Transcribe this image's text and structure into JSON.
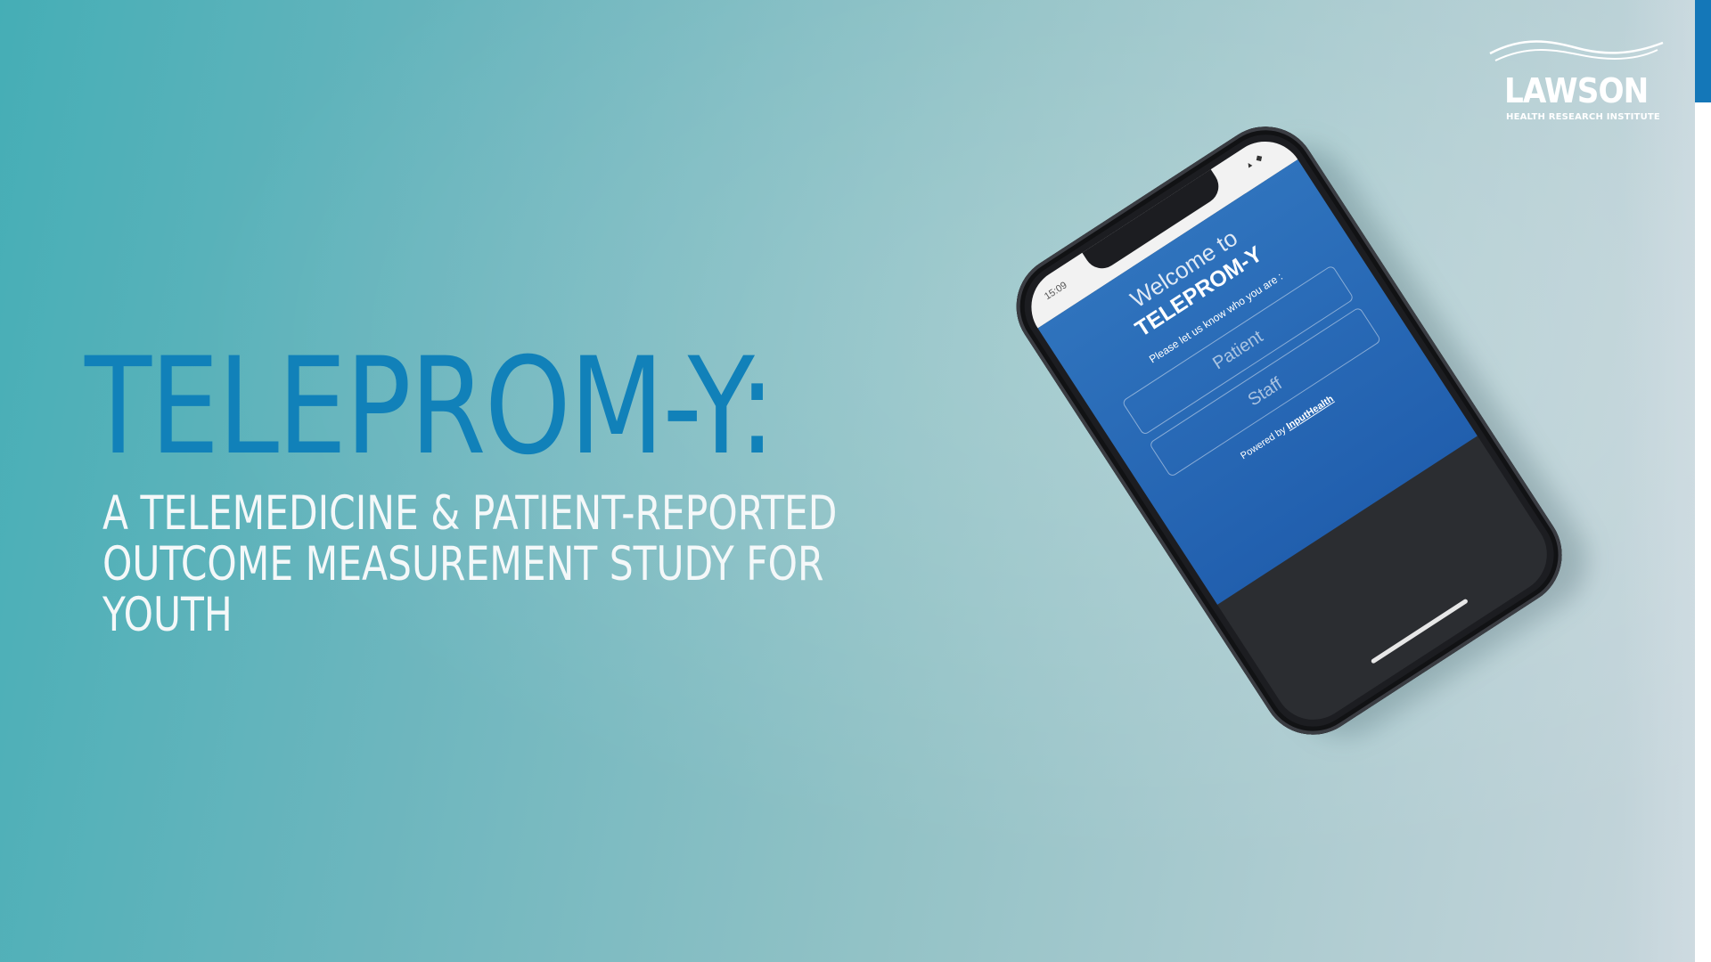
{
  "slide": {
    "title": "TELEPROM-Y:",
    "subtitle_lines": [
      "A TELEMEDICINE & PATIENT-REPORTED",
      "OUTCOME MEASUREMENT STUDY FOR",
      "YOUTH"
    ]
  },
  "logo": {
    "name": "LAWSON",
    "tagline": "HEALTH RESEARCH INSTITUTE"
  },
  "phone": {
    "status_time": "15:09",
    "welcome": "Welcome to",
    "app_title": "TELEPROM-Y",
    "prompt": "Please let us know who you are :",
    "patient_button": "Patient",
    "staff_button": "Staff",
    "powered_by_prefix": "Powered by",
    "powered_by_brand": "InputHealth"
  },
  "colors": {
    "title": "#1181b9",
    "subtitle": "#f4f8f9",
    "accent_bar": "#1477b8",
    "app_blue": "#2f73bd"
  }
}
